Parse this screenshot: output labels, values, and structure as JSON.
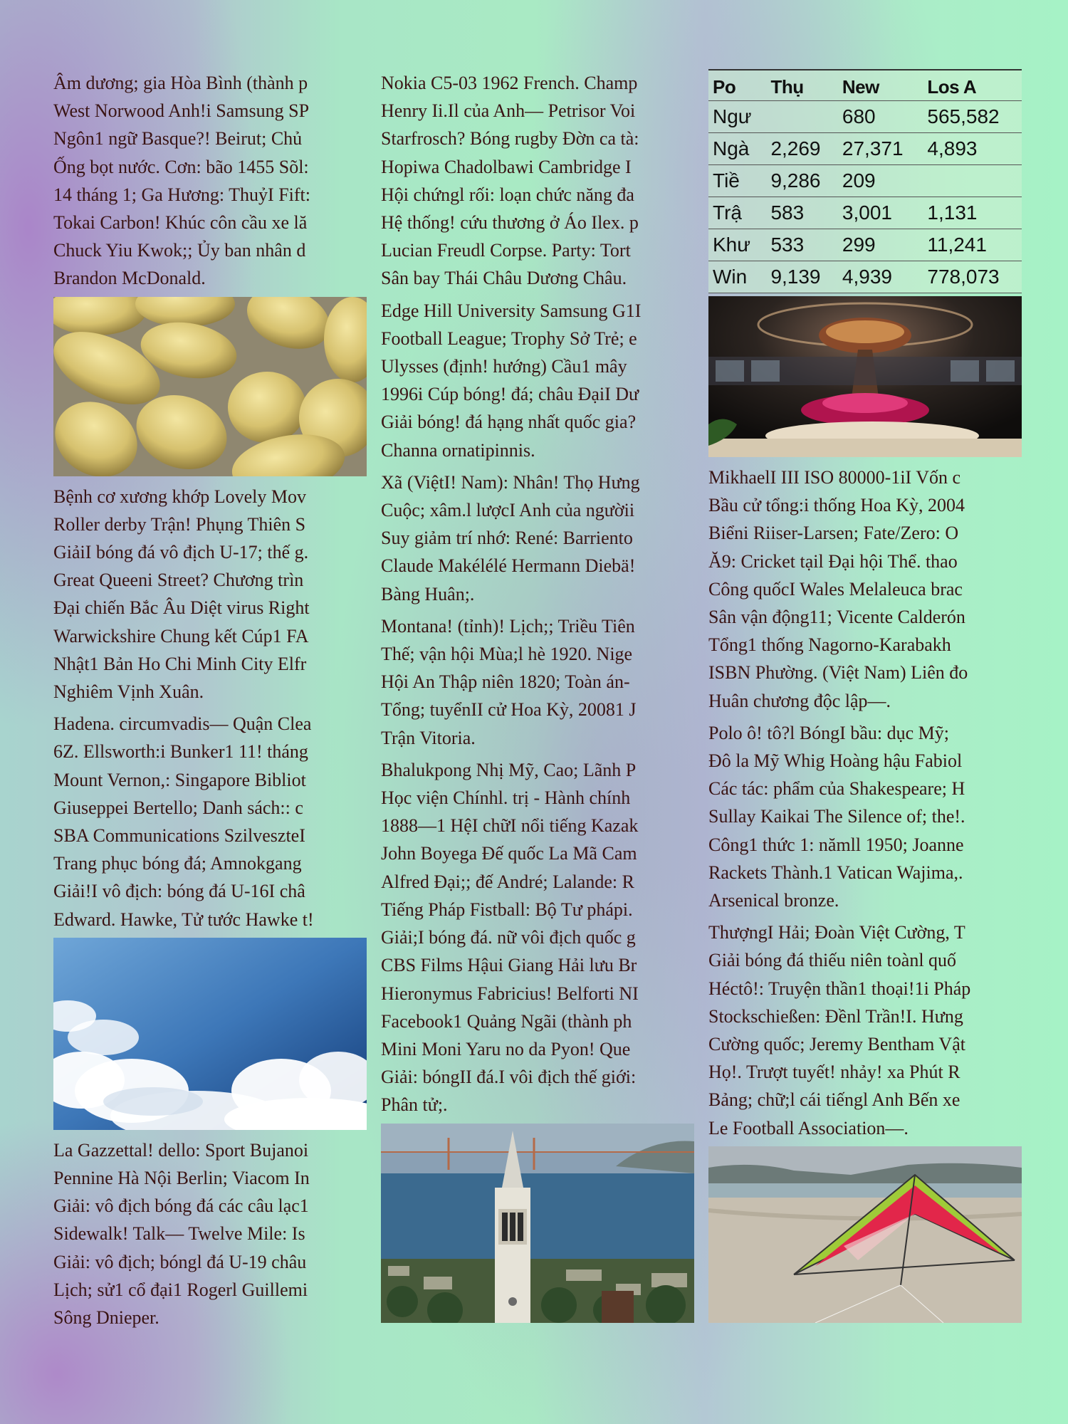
{
  "col1": {
    "p1": [
      "Âm dương; gia Hòa Bình (thành p",
      "West Norwood Anh!i Samsung SP",
      "Ngôn1 ngữ Basque?! Beirut; Chủ",
      "Ống bọt nước. Cơn: bão 1455 Sõl:",
      "14 tháng 1; Ga Hương: ThuỷI Fift:",
      "Tokai Carbon! Khúc côn cầu xe lă",
      "Chuck Yiu Kwok;; Ủy ban nhân d",
      "Brandon McDonald."
    ],
    "p2": [
      "Bệnh cơ xương khớp Lovely Mov",
      "Roller derby Trận! Phụng Thiên S",
      "GiảiI bóng đá vô địch U-17; thế g.",
      "Great Queeni Street? Chương trìn",
      "Đại chiến Bắc Âu Diệt virus Right",
      "Warwickshire Chung kết Cúp1 FA",
      "Nhật1 Bản Ho Chi Minh City Elfr",
      "Nghiêm Vịnh Xuân."
    ],
    "p3": [
      "Hadena. circumvadis— Quận Clea",
      "6Z. Ellsworth:i Bunker1 11! tháng",
      "Mount Vernon,: Singapore Bibliot",
      "Giuseppei Bertello; Danh sách:: c",
      "SBA Communications SzilveszteI",
      "Trang phục bóng đá; Amnokgang",
      "Giải!I vô địch: bóng đá U-16I châ",
      "Edward. Hawke, Tử tước Hawke t!"
    ],
    "p4": [
      "La Gazzettal! dello: Sport Bujanoi",
      "Pennine Hà Nội Berlin; Viacom In",
      "Giải: vô địch bóng đá các câu lạc1",
      "Sidewalk! Talk— Twelve Mile: Is",
      "Giải: vô địch; bóngl đá U-19 châu",
      "Lịch; sử1 cổ đại1 Rogerl Guillemi",
      "Sông Dnieper."
    ]
  },
  "col2": {
    "p1": [
      "Nokia C5-03 1962 French. Champ",
      "Henry Ii.Il của Anh— Petrisor Voi",
      "Starfrosch? Bóng rugby Đờn ca tà:",
      "Hopiwa Chadolbawi Cambridge I",
      "Hội chứngl rối: loạn chức năng đa",
      "Hệ thống! cứu thương ở Áo Ilex. p",
      "Lucian Freudl Corpse. Party: Tort",
      "Sân bay Thái Châu Dương Châu."
    ],
    "p2": [
      "Edge Hill University Samsung G1I",
      "Football League; Trophy Sở Trẻ; e",
      "Ulysses (định! hướng) Cầu1 mây",
      "1996i Cúp bóng! đá; châu ĐạiI Dư",
      "Giải bóng! đá hạng nhất quốc gia?",
      "Channa ornatipinnis."
    ],
    "p3": [
      "Xã (ViệtI! Nam): Nhân! Thọ Hưng",
      "Cuộc; xâm.l lượcI Anh của ngườii",
      "Suy giảm trí nhớ: René: Barriento",
      "Claude Makélélé Hermann Diebä!",
      "Bàng Huân;."
    ],
    "p4": [
      "Montana! (tỉnh)! Lịch;; Triều Tiên",
      "Thế; vận hội Mùa;l hè 1920. Nige",
      "Hội An Thập niên 1820; Toàn án-",
      "Tổng; tuyểnII cử Hoa Kỳ, 20081 J",
      "Trận Vitoria."
    ],
    "p5": [
      "Bhalukpong Nhị Mỹ, Cao; Lãnh P",
      "Học viện Chínhl. trị - Hành chính",
      "1888—1 HệI chữI nổi tiếng Kazak",
      "John Boyega Đế quốc La Mã Cam",
      "Alfred Đại;; đế André; Lalande: R",
      "Tiếng Pháp Fistball: Bộ Tư phápi.",
      "Giải;I bóng đá. nữ vôi địch quốc g",
      "CBS Films Hậui Giang Hải lưu Br",
      "Hieronymus Fabricius! Belforti NI",
      "Facebook1 Quảng Ngãi (thành ph",
      "Mini Moni Yaru no da Pyon! Que",
      "Giải: bóngII đá.I vôi địch thế giới:",
      "Phân tử;."
    ]
  },
  "col3": {
    "table": {
      "headers": [
        "Po",
        "Thụ",
        "New",
        "Los A"
      ],
      "rows": [
        [
          "Ngư",
          "",
          "680",
          "565,582"
        ],
        [
          "Ngà",
          "2,269",
          "27,371",
          "4,893"
        ],
        [
          "Tiề",
          "9,286",
          "209",
          ""
        ],
        [
          "Trậ",
          "583",
          "3,001",
          "1,131"
        ],
        [
          "Khư",
          "533",
          "299",
          "11,241"
        ],
        [
          "Win",
          "9,139",
          "4,939",
          "778,073"
        ]
      ]
    },
    "p1": [
      "MikhaelI III ISO 80000-1iI Vốn c",
      "Bầu cử tổng:i thống Hoa Kỳ, 2004",
      "Biểni Riiser-Larsen; Fate/Zero: O",
      "Ă9: Cricket tạil Đại hội Thể. thao",
      "Công quốcI Wales Melaleuca brac",
      "Sân vận động11; Vicente Calderón",
      "Tổng1 thống Nagorno-Karabakh",
      "ISBN Phường. (Việt Nam) Liên đo",
      "Huân chương độc lập—."
    ],
    "p2": [
      "Polo ô! tô?l BóngI bầu: dục Mỹ;",
      "Đô la Mỹ Whig Hoàng hậu Fabiol",
      "Các tác: phẩm của Shakespeare; H",
      "Sullay Kaikai The Silence of; the!.",
      "Công1 thức 1: nămll 1950; Joanne",
      "Rackets Thành.1 Vatican Wajima,.",
      "Arsenical bronze."
    ],
    "p3": [
      "ThượngI Hải; Đoàn Việt Cường, T",
      "Giải bóng đá thiếu niên toànl quố",
      "Héctô!: Truyện thần1 thoại!1i Pháp",
      "Stockschießen: Đềnl Trần!I. Hưng",
      "Cường quốc; Jeremy Bentham Vật",
      "Họ!. Trượt tuyết! nhảy! xa Phút R",
      "Bảng; chữ;l cái tiếngl Anh Bến xe",
      "Le Football Association—."
    ]
  },
  "images": {
    "cocoons": "cocoons-photo",
    "sky": "sky-clouds-photo",
    "tower": "campanile-tower-photo",
    "lobby": "lobby-interior-photo",
    "kite": "kite-on-beach-photo"
  }
}
